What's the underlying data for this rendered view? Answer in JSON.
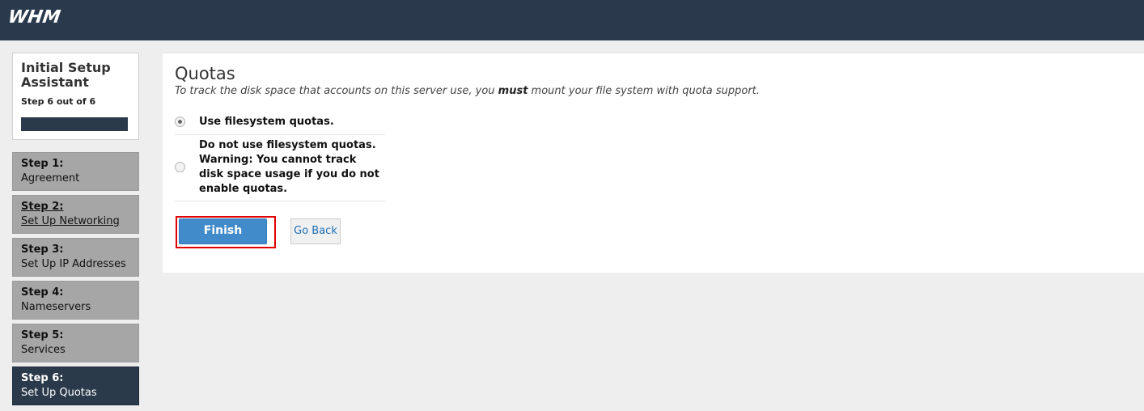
{
  "header": {
    "logo": "WHM"
  },
  "sidebar": {
    "title_line1": "Initial Setup",
    "title_line2": "Assistant",
    "step_counter": "Step 6 out of 6",
    "progress": 1.0,
    "steps": [
      {
        "num": "Step 1:",
        "label": "Agreement"
      },
      {
        "num": "Step 2:",
        "label": "Set Up Networking"
      },
      {
        "num": "Step 3:",
        "label": "Set Up IP Addresses"
      },
      {
        "num": "Step 4:",
        "label": "Nameservers"
      },
      {
        "num": "Step 5:",
        "label": "Services"
      },
      {
        "num": "Step 6:",
        "label": "Set Up Quotas"
      }
    ]
  },
  "main": {
    "title": "Quotas",
    "desc_prefix": "To track the disk space that accounts on this server use, you ",
    "desc_bold": "must",
    "desc_suffix": " mount your file system with quota support.",
    "options": [
      {
        "label": "Use filesystem quotas.",
        "selected": true
      },
      {
        "label": "Do not use filesystem quotas. Warning: You cannot track disk space usage if you do not enable quotas.",
        "selected": false
      }
    ],
    "finish_label": "Finish",
    "go_back_label": "Go Back"
  },
  "colors": {
    "header_bg": "#2a3a4c",
    "active_step_bg": "#2b3a4b",
    "inactive_step_bg": "#a6a6a6",
    "primary_button": "#428bca",
    "highlight": "#e10000"
  }
}
